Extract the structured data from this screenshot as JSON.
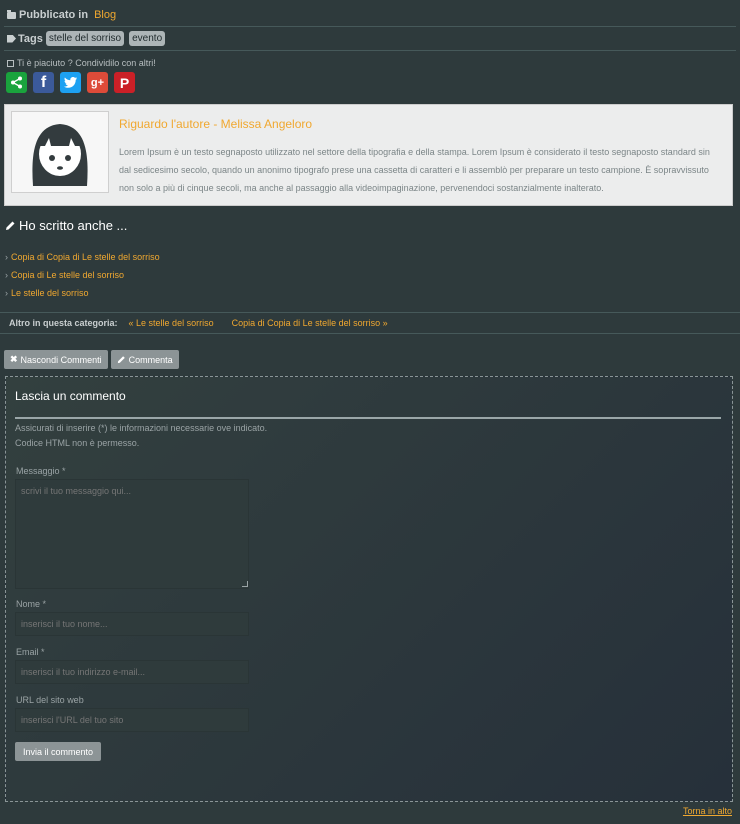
{
  "meta": {
    "published_label": "Pubblicato in",
    "published_category": "Blog",
    "tags_label": "Tags",
    "tags": [
      "stelle del sorriso",
      "evento"
    ]
  },
  "share": {
    "label": "Ti è piaciuto ? Condividilo con altri!",
    "buttons": [
      {
        "name": "share",
        "icon": "share-icon",
        "glyph": "<",
        "color": "#1aa33d"
      },
      {
        "name": "facebook",
        "icon": "facebook-icon",
        "glyph": "f",
        "color": "#3b5a9a"
      },
      {
        "name": "twitter",
        "icon": "twitter-icon",
        "glyph": "t",
        "color": "#1da1f2"
      },
      {
        "name": "google-plus",
        "icon": "google-plus-icon",
        "glyph": "g+",
        "color": "#dd4b39"
      },
      {
        "name": "pinterest",
        "icon": "pinterest-icon",
        "glyph": "P",
        "color": "#cb2027"
      }
    ]
  },
  "author": {
    "title": "Riguardo l'autore - Melissa Angeloro",
    "description": "Lorem Ipsum è un testo segnaposto utilizzato nel settore della tipografia e della stampa. Lorem Ipsum è considerato il testo segnaposto standard sin dal sedicesimo secolo, quando un anonimo tipografo prese una cassetta di caratteri e li assemblò per preparare un testo campione. È sopravvissuto non solo a più di cinque secoli, ma anche al passaggio alla videoimpaginazione, pervenendoci sostanzialmente inalterato."
  },
  "also": {
    "title": "Ho scritto anche ...",
    "items": [
      "Copia di Copia di Le stelle del sorriso",
      "Copia di Le stelle del sorriso",
      "Le stelle del sorriso"
    ]
  },
  "category_nav": {
    "label": "Altro in questa categoria:",
    "prev": "« Le stelle del sorriso",
    "next": "Copia di Copia di Le stelle del sorriso »"
  },
  "actions": {
    "hide_comments": "Nascondi Commenti",
    "comment": "Commenta"
  },
  "form": {
    "title": "Lascia un commento",
    "note1": "Assicurati di inserire (*) le informazioni necessarie ove indicato.",
    "note2": "Codice HTML non è permesso.",
    "message_label": "Messaggio *",
    "message_placeholder": "scrivi il tuo messaggio qui...",
    "name_label": "Nome *",
    "name_placeholder": "inserisci il tuo nome...",
    "email_label": "Email *",
    "email_placeholder": "inserisci il tuo indirizzo e-mail...",
    "url_label": "URL del sito web",
    "url_placeholder": "inserisci l'URL del tuo sito",
    "submit": "Invia il commento"
  },
  "footer": {
    "back_to_top": "Torna in alto"
  },
  "colors": {
    "background": "#2e3a3c",
    "link": "#f0a830",
    "button": "#8c9496"
  }
}
